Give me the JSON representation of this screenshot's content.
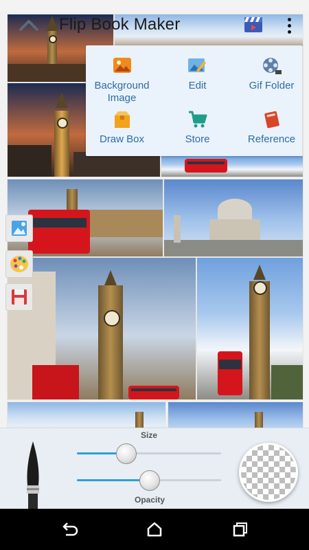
{
  "app": {
    "title": "Flip Book Maker"
  },
  "icons": {
    "back": "chevron-up-icon",
    "gallery": "clapperboard-icon",
    "more": "more-vert-icon"
  },
  "menu": {
    "items": [
      {
        "label": "Background\nImage",
        "icon": "image-icon"
      },
      {
        "label": "Edit",
        "icon": "edit-image-icon"
      },
      {
        "label": "Gif Folder",
        "icon": "film-reel-icon"
      },
      {
        "label": "Draw Box",
        "icon": "box-icon"
      },
      {
        "label": "Store",
        "icon": "cart-icon"
      },
      {
        "label": "Reference",
        "icon": "book-icon"
      }
    ]
  },
  "side_tools": [
    "image-icon",
    "palette-icon",
    "save-icon"
  ],
  "brush_panel": {
    "size_label": "Size",
    "opacity_label": "Opacity",
    "size_value": 0.34,
    "opacity_value": 0.5
  },
  "nav": [
    "back-nav-icon",
    "home-nav-icon",
    "recents-nav-icon"
  ],
  "colors": {
    "accent": "#2f9fd8",
    "menu_text": "#2c6ea7",
    "bus_red": "#d4161c"
  }
}
